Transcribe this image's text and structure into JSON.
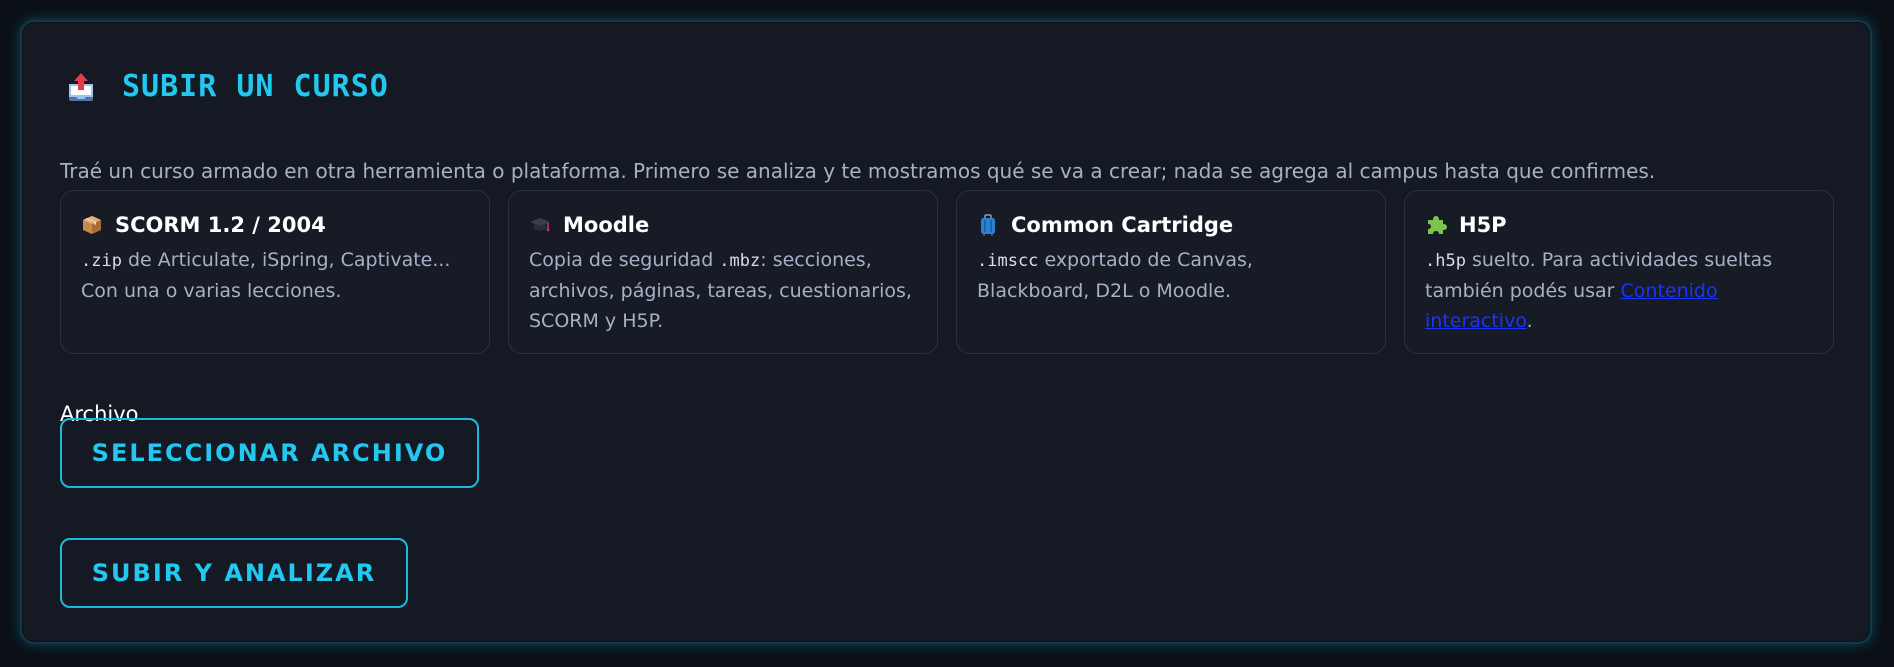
{
  "panel": {
    "title": "SUBIR UN CURSO",
    "title_icon": "upload-tray-icon",
    "intro": "Traé un curso armado en otra herramienta o plataforma. Primero se analiza y te mostramos qué se va a crear; nada se agrega al campus hasta que confirmes."
  },
  "formats": [
    {
      "icon": "package-icon",
      "title": "SCORM 1.2 / 2004",
      "code": ".zip",
      "text": " de Articulate, iSpring, Captivate... Con una o varias lecciones."
    },
    {
      "icon": "graduation-cap-icon",
      "title": "Moodle",
      "text_before": "Copia de seguridad ",
      "code": ".mbz",
      "text": ": secciones, archivos, páginas, tareas, cuestionarios, SCORM y H5P."
    },
    {
      "icon": "luggage-icon",
      "title": "Common Cartridge",
      "code": ".imscc",
      "text": " exportado de Canvas, Blackboard, D2L o Moodle."
    },
    {
      "icon": "puzzle-icon",
      "title": "H5P",
      "code": ".h5p",
      "text": " suelto. Para actividades sueltas también podés usar ",
      "link": "Contenido interactivo",
      "text_after": "."
    }
  ],
  "file_field": {
    "label": "Archivo",
    "select_button": "SELECCIONAR ARCHIVO"
  },
  "submit_button": "SUBIR Y ANALIZAR",
  "colors": {
    "accent": "#22c8ef",
    "panel_bg": "#141924",
    "link": "#1a33ff"
  }
}
